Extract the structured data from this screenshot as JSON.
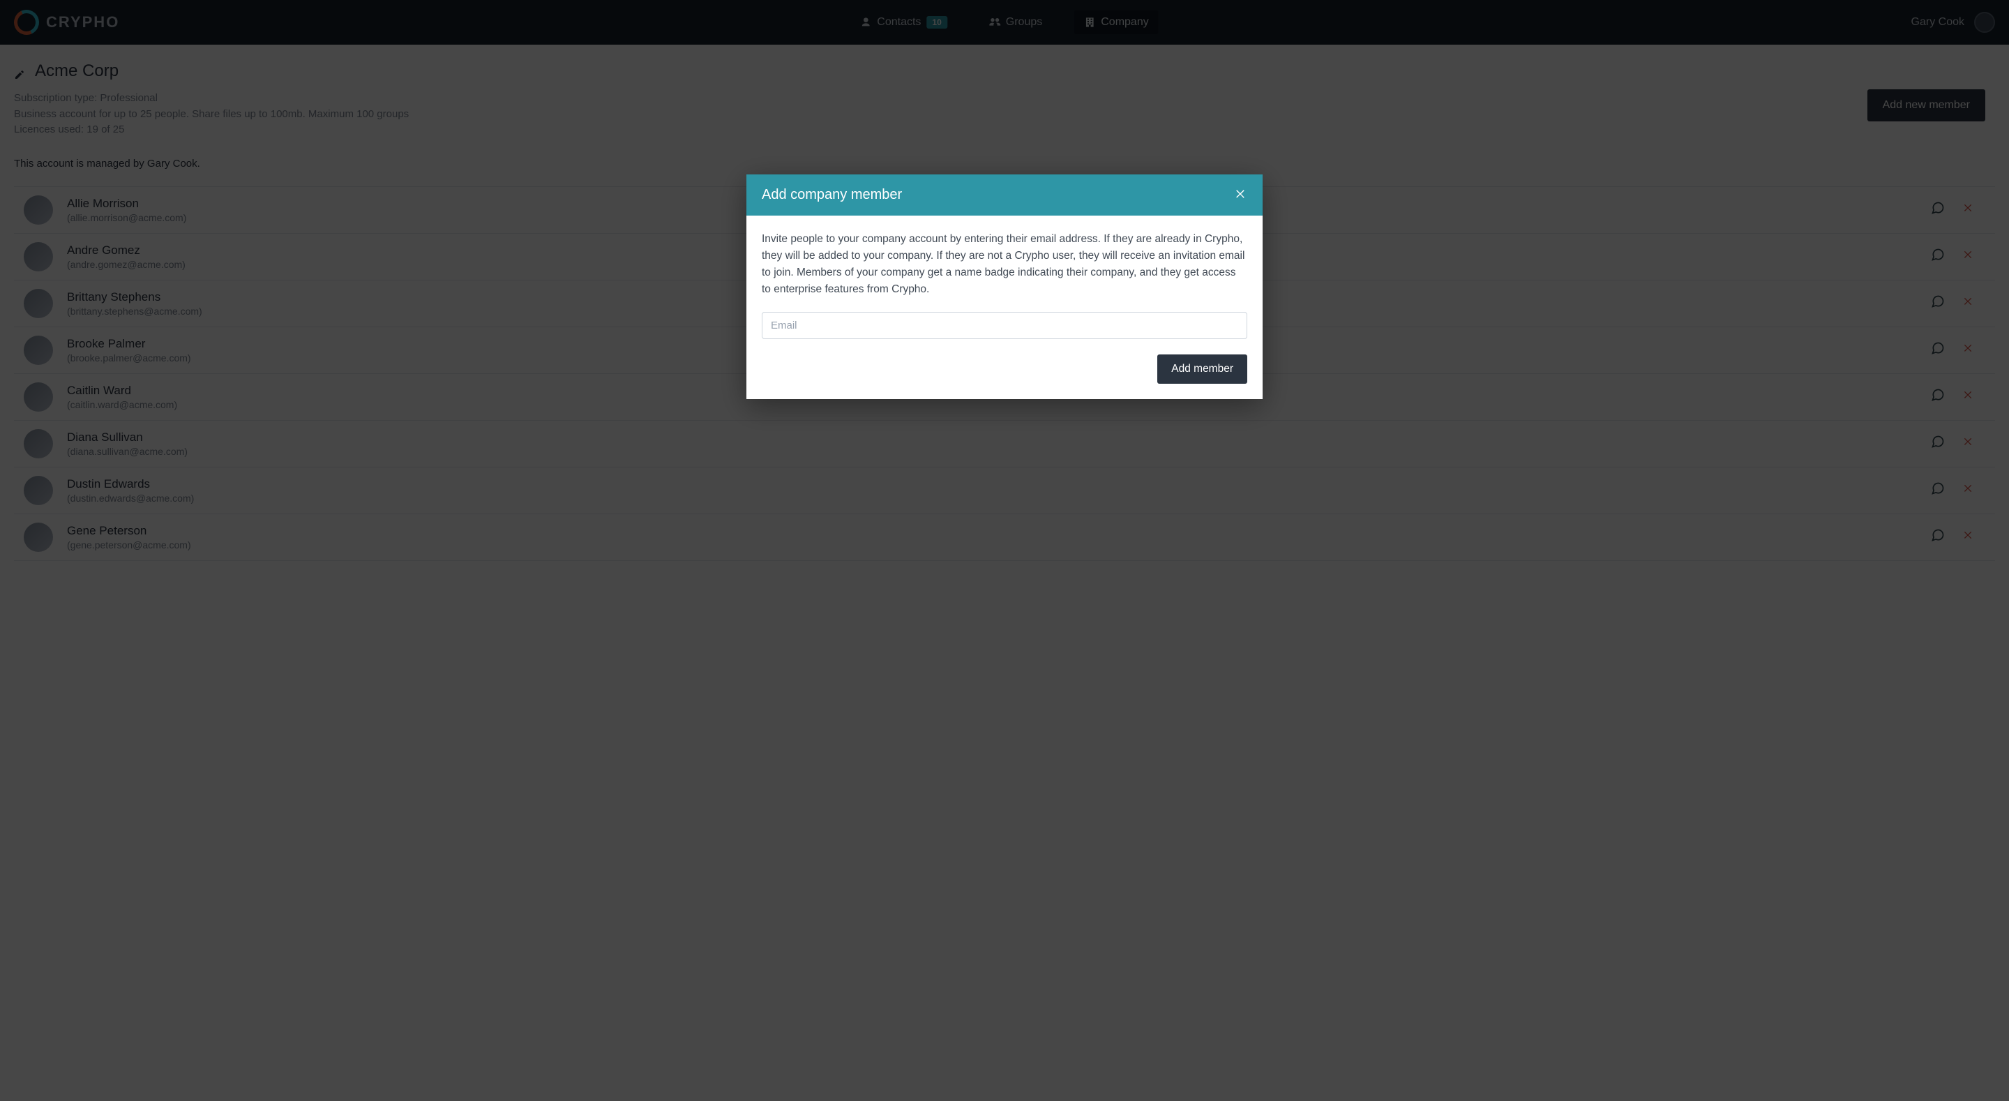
{
  "brand": {
    "name": "CRYPHO"
  },
  "nav": {
    "contacts": {
      "label": "Contacts",
      "badge": "10"
    },
    "groups": {
      "label": "Groups"
    },
    "company": {
      "label": "Company"
    }
  },
  "user": {
    "display_name": "Gary Cook"
  },
  "company_page": {
    "name": "Acme Corp",
    "subscription_label": "Subscription type: Professional",
    "plan_desc": "Business account for up to 25 people. Share files up to 100mb. Maximum 100 groups",
    "licences": "Licences used: 19 of 25",
    "managed_by": "This account is managed by Gary Cook.",
    "add_member_button": "Add new member"
  },
  "members": [
    {
      "name": "Allie Morrison",
      "email": "(allie.morrison@acme.com)"
    },
    {
      "name": "Andre Gomez",
      "email": "(andre.gomez@acme.com)"
    },
    {
      "name": "Brittany Stephens",
      "email": "(brittany.stephens@acme.com)"
    },
    {
      "name": "Brooke Palmer",
      "email": "(brooke.palmer@acme.com)"
    },
    {
      "name": "Caitlin Ward",
      "email": "(caitlin.ward@acme.com)"
    },
    {
      "name": "Diana Sullivan",
      "email": "(diana.sullivan@acme.com)"
    },
    {
      "name": "Dustin Edwards",
      "email": "(dustin.edwards@acme.com)"
    },
    {
      "name": "Gene Peterson",
      "email": "(gene.peterson@acme.com)"
    }
  ],
  "modal": {
    "title": "Add company member",
    "body": "Invite people to your company account by entering their email address. If they are already in Crypho, they will be added to your company. If they are not a Crypho user, they will receive an invitation email to join. Members of your company get a name badge indicating their company, and they get access to enterprise features from Crypho.",
    "email_placeholder": "Email",
    "submit_label": "Add member"
  }
}
